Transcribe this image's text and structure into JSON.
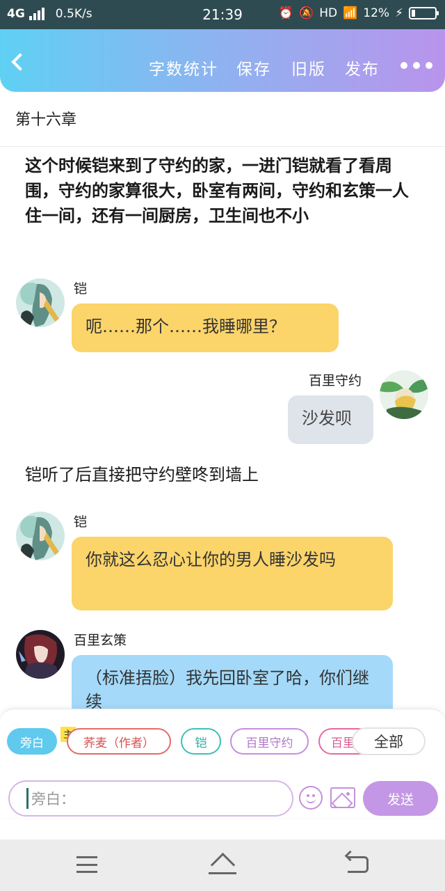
{
  "status_bar": {
    "network": "4G",
    "speed": "0.5K/s",
    "time": "21:39",
    "hd": "HD",
    "battery": "12%"
  },
  "header": {
    "actions": [
      "字数统计",
      "保存",
      "旧版",
      "发布"
    ]
  },
  "chapter_title": "第十六章",
  "messages": [
    {
      "type": "narration",
      "text": "这个时候铠来到了守约的家，一进门铠就看了看周围，守约的家算很大，卧室有两间，守约和玄策一人住一间，还有一间厨房，卫生间也不小"
    },
    {
      "type": "left",
      "name": "铠",
      "text": "呃……那个……我睡哪里？"
    },
    {
      "type": "right",
      "name": "百里守约",
      "text": "沙发呗"
    },
    {
      "type": "narration",
      "text": "铠听了后直接把守约壁咚到墙上"
    },
    {
      "type": "left",
      "name": "铠",
      "text": "你就这么忍心让你的男人睡沙发吗"
    },
    {
      "type": "left",
      "name": "百里玄策",
      "text": "（标准捂脸）我先回卧室了哈，你们继续"
    }
  ],
  "roles": {
    "items": [
      "旁白",
      "荞麦（作者）",
      "铠",
      "百里守约",
      "百里玄策"
    ],
    "author_badge": "主",
    "all_label": "全部"
  },
  "composer": {
    "placeholder": "旁白：",
    "send_label": "发送"
  },
  "colors": {
    "accent_start": "#5fd0f3",
    "accent_end": "#b994ec",
    "bubble_yellow": "#fbd46a",
    "bubble_gray": "#dfe4ea",
    "bubble_blue": "#a4d9f9"
  }
}
